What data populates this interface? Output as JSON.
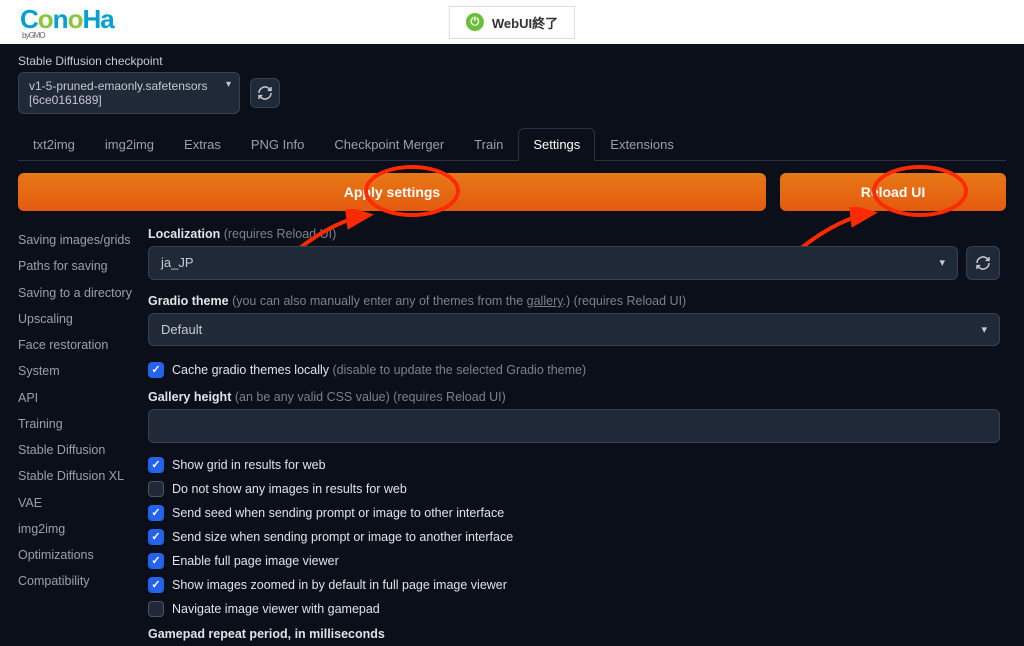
{
  "topbar": {
    "logo_text": "ConoHa",
    "logo_sub": "byGMO",
    "webui_end": "WebUI終了"
  },
  "checkpoint": {
    "label": "Stable Diffusion checkpoint",
    "value": "v1-5-pruned-emaonly.safetensors [6ce0161689]"
  },
  "tabs": [
    "txt2img",
    "img2img",
    "Extras",
    "PNG Info",
    "Checkpoint Merger",
    "Train",
    "Settings",
    "Extensions"
  ],
  "active_tab": "Settings",
  "buttons": {
    "apply": "Apply settings",
    "reload": "Reload UI"
  },
  "sidebar": [
    "Saving images/grids",
    "Paths for saving",
    "Saving to a directory",
    "Upscaling",
    "Face restoration",
    "System",
    "API",
    "Training",
    "Stable Diffusion",
    "Stable Diffusion XL",
    "VAE",
    "img2img",
    "Optimizations",
    "Compatibility"
  ],
  "settings": {
    "localization": {
      "label": "Localization",
      "hint": "(requires Reload UI)",
      "value": "ja_JP"
    },
    "gradio_theme": {
      "label": "Gradio theme",
      "hint1": "(you can also manually enter any of themes from the ",
      "link": "gallery",
      "hint2": ".) (requires Reload UI)",
      "value": "Default"
    },
    "cache_themes": {
      "label": "Cache gradio themes locally",
      "hint": "(disable to update the selected Gradio theme)",
      "checked": true
    },
    "gallery_height": {
      "label": "Gallery height",
      "hint": "(an be any valid CSS value) (requires Reload UI)",
      "value": ""
    },
    "show_grid": {
      "label": "Show grid in results for web",
      "checked": true
    },
    "no_images": {
      "label": "Do not show any images in results for web",
      "checked": false
    },
    "send_seed": {
      "label": "Send seed when sending prompt or image to other interface",
      "checked": true
    },
    "send_size": {
      "label": "Send size when sending prompt or image to another interface",
      "checked": true
    },
    "full_viewer": {
      "label": "Enable full page image viewer",
      "checked": true
    },
    "zoomed_default": {
      "label": "Show images zoomed in by default in full page image viewer",
      "checked": true
    },
    "gamepad_nav": {
      "label": "Navigate image viewer with gamepad",
      "checked": false
    },
    "gamepad_repeat": {
      "label": "Gamepad repeat period, in milliseconds"
    }
  }
}
